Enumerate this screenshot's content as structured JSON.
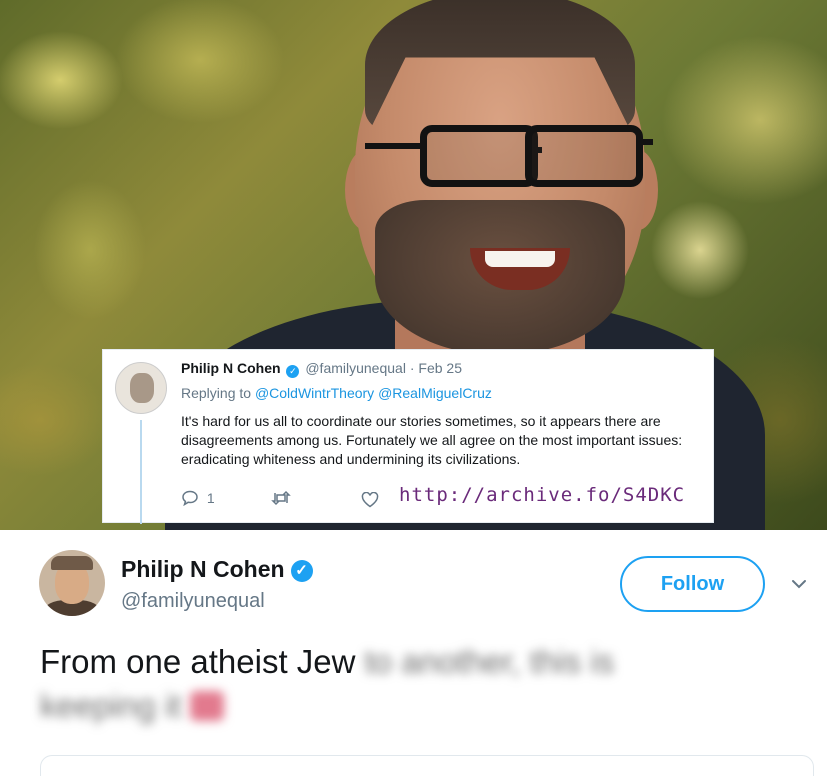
{
  "embedded_tweet": {
    "author_name": "Philip N Cohen",
    "author_handle": "@familyunequal",
    "separator": "·",
    "date": "Feb 25",
    "replying_to_label": "Replying to",
    "reply_mentions": [
      "@ColdWintrTheory",
      "@RealMiguelCruz"
    ],
    "text": "It's hard for us all to coordinate our stories sometimes, so it appears there are disagreements among us. Fortunately we all agree on the most important issues: eradicating whiteness and undermining its civilizations.",
    "reply_count": "1",
    "archive_url": "http://archive.fo/S4DKC",
    "icons": [
      "reply-icon",
      "retweet-icon",
      "like-icon"
    ]
  },
  "tweet": {
    "author_name": "Philip N Cohen",
    "author_handle": "@familyunequal",
    "verified_icon": "check",
    "follow_label": "Follow",
    "text_visible": "From one atheist Jew",
    "text_blurred_line1": "to another, this is",
    "text_blurred_line2": "keeping it"
  },
  "colors": {
    "accent": "#1da1f2",
    "mention": "#1b95e0",
    "muted": "#657786",
    "archive_link": "#6a2a7a"
  }
}
